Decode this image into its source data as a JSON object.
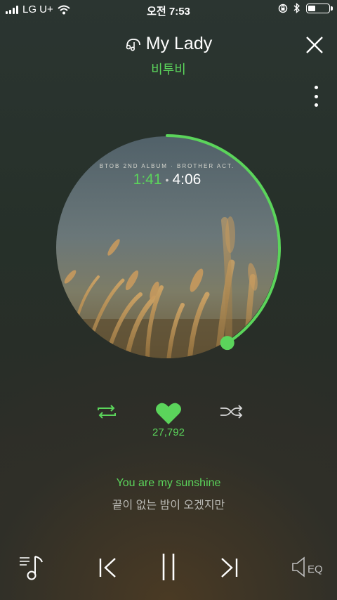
{
  "status_bar": {
    "carrier": "LG U+",
    "time": "오전 7:53",
    "battery_level": 0.35
  },
  "header": {
    "title": "My Lady",
    "artist": "비투비"
  },
  "player": {
    "album_text": "BTOB 2ND ALBUM · BROTHER ACT.",
    "current_time": "1:41",
    "separator": "•",
    "total_time": "4:06",
    "progress": 0.41
  },
  "actions": {
    "like_count": "27,792"
  },
  "lyrics": {
    "current_line": "You are my sunshine",
    "next_line": "끝이 없는 밤이 오겠지만"
  },
  "bottom_bar": {
    "eq_label": "EQ"
  },
  "colors": {
    "accent": "#5bd45b"
  }
}
